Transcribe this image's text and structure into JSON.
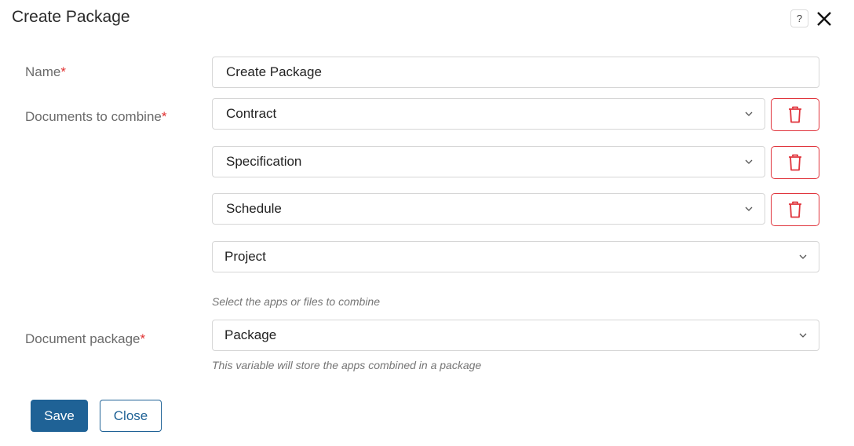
{
  "dialog": {
    "title": "Create Package",
    "help_icon": "question-icon",
    "close_icon": "close-x-icon"
  },
  "form": {
    "name": {
      "label": "Name",
      "required_mark": "*",
      "value": "Create Package"
    },
    "documents": {
      "label": "Documents to combine",
      "required_mark": "*",
      "items": [
        {
          "value": "Contract",
          "removable": true
        },
        {
          "value": "Specification",
          "removable": true
        },
        {
          "value": "Schedule",
          "removable": true
        },
        {
          "value": "Project",
          "removable": false
        }
      ],
      "hint": "Select the apps or files to combine"
    },
    "package": {
      "label": "Document package",
      "required_mark": "*",
      "value": "Package",
      "hint": "This variable will store the apps combined in a package"
    }
  },
  "buttons": {
    "save": "Save",
    "close": "Close"
  },
  "colors": {
    "primary": "#1f6296",
    "danger": "#e0343c",
    "required": "#e03030"
  }
}
